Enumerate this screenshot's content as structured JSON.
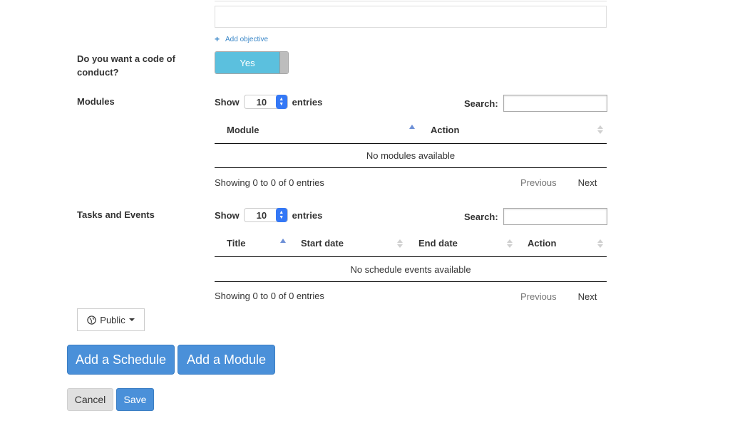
{
  "objective": {
    "input_value": "",
    "add_label": "Add objective"
  },
  "code_of_conduct": {
    "label": "Do you want a code of conduct?",
    "toggle_value": "Yes"
  },
  "modules": {
    "label": "Modules",
    "show_label": "Show",
    "entries_value": "10",
    "entries_label": "entries",
    "search_label": "Search:",
    "search_value": "",
    "columns": [
      "Module",
      "Action"
    ],
    "empty_message": "No modules available",
    "info": "Showing 0 to 0 of 0 entries",
    "previous": "Previous",
    "next": "Next"
  },
  "tasks": {
    "label": "Tasks and Events",
    "show_label": "Show",
    "entries_value": "10",
    "entries_label": "entries",
    "search_label": "Search:",
    "search_value": "",
    "columns": [
      "Title",
      "Start date",
      "End date",
      "Action"
    ],
    "empty_message": "No schedule events available",
    "info": "Showing 0 to 0 of 0 entries",
    "previous": "Previous",
    "next": "Next"
  },
  "visibility": {
    "value": "Public",
    "icon": "globe-icon"
  },
  "actions": {
    "add_schedule": "Add a Schedule",
    "add_module": "Add a Module",
    "cancel": "Cancel",
    "save": "Save"
  },
  "colors": {
    "accent": "#4a90d9",
    "toggle_on": "#5bc0de",
    "link": "#3a87c8"
  }
}
